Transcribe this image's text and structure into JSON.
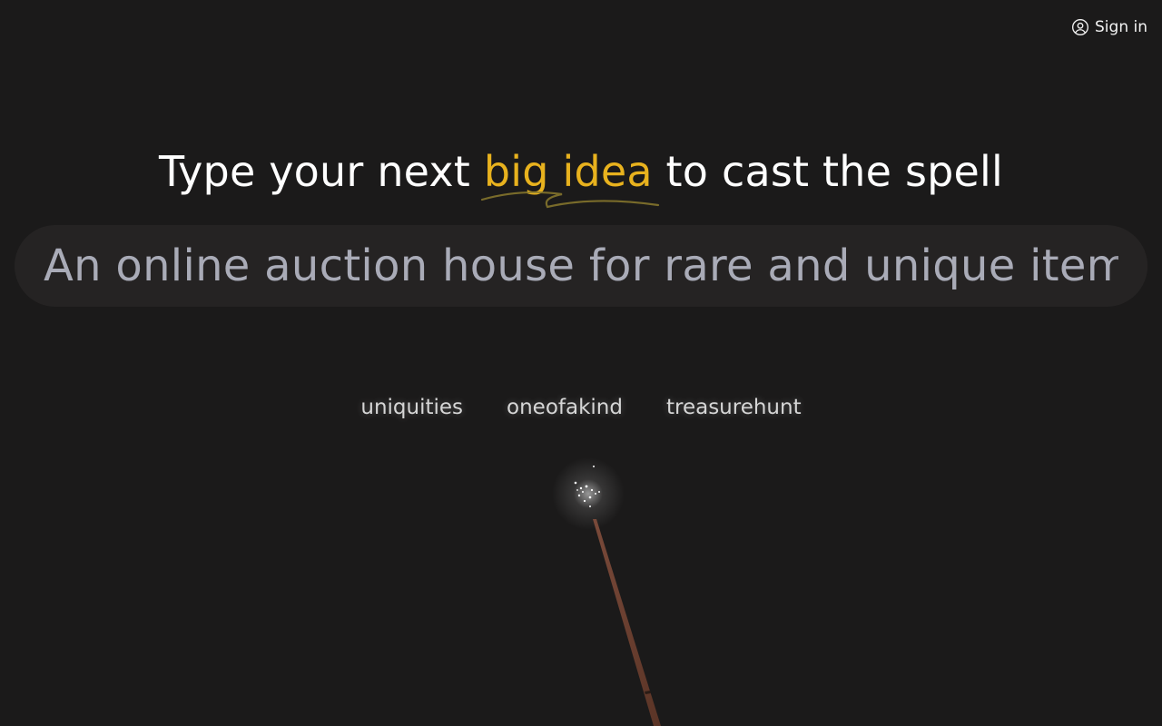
{
  "header": {
    "signin_label": "Sign in",
    "signin_icon": "user-circle-icon"
  },
  "headline": {
    "before": "Type your next ",
    "highlight": "big idea",
    "after": " to cast the spell",
    "highlight_color": "#e8b21e"
  },
  "idea_input": {
    "value": "An online auction house for rare and unique items"
  },
  "suggestions": [
    {
      "label": "uniquities"
    },
    {
      "label": "oneofakind"
    },
    {
      "label": "treasurehunt"
    }
  ],
  "wand": {
    "icon": "magic-wand-icon",
    "sparkle_icon": "sparkles-icon"
  },
  "colors": {
    "background": "#1b1a1a",
    "input_background": "#252323",
    "input_text": "#a9abb7",
    "accent": "#e8b21e"
  }
}
